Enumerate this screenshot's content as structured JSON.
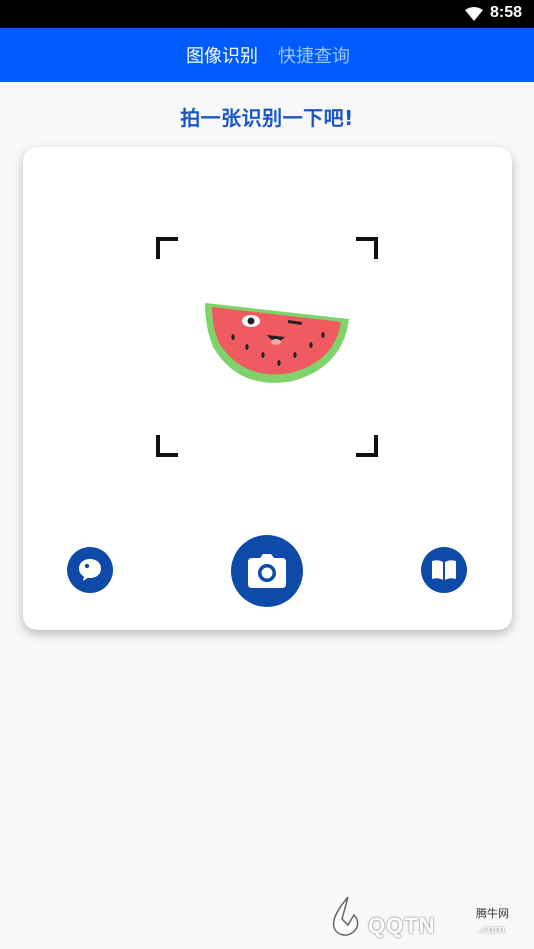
{
  "status_bar": {
    "time": "8:58",
    "wifi_icon": "wifi-icon"
  },
  "tabs": [
    {
      "label": "图像识别",
      "active": true
    },
    {
      "label": "快捷查询",
      "active": false
    }
  ],
  "slogan": "拍一张识别一下吧!",
  "card": {
    "image_icon": "watermelon-icon",
    "buttons": [
      {
        "icon": "chat-bubble-icon"
      },
      {
        "icon": "camera-icon"
      },
      {
        "icon": "book-icon"
      }
    ]
  },
  "watermark": {
    "site": "腾牛网",
    "brand": "QQTN",
    "domain": ".com"
  },
  "colors": {
    "accent": "#005bff",
    "button": "#0e4aa8",
    "slogan": "#1856c9"
  }
}
